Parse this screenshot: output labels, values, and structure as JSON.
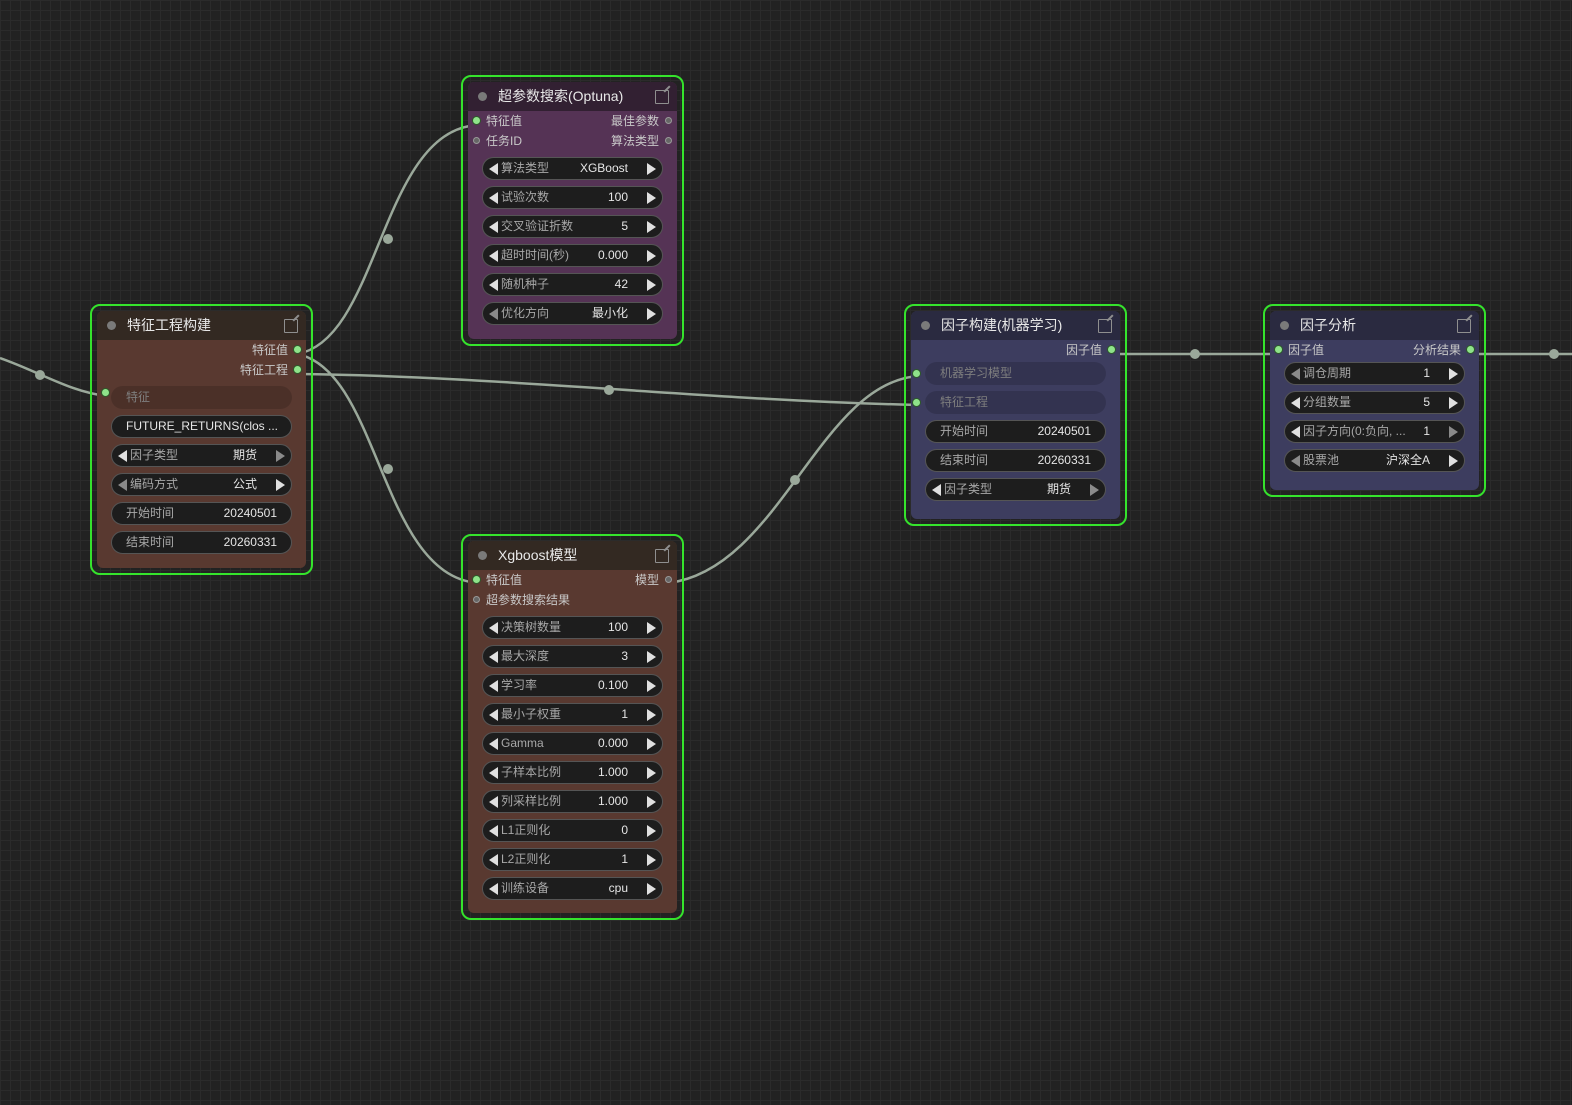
{
  "nodes": {
    "feature": {
      "title": "特征工程构建",
      "outputs": [
        "特征值",
        "特征工程"
      ],
      "input_label": "特征",
      "formula": "FUTURE_RETURNS(clos ...",
      "widgets": [
        {
          "label": "因子类型",
          "value": "期货"
        },
        {
          "label": "编码方式",
          "value": "公式"
        },
        {
          "label": "开始时间",
          "value": "20240501"
        },
        {
          "label": "结束时间",
          "value": "20260331"
        }
      ]
    },
    "optuna": {
      "title": "超参数搜索(Optuna)",
      "inputs": [
        "特征值",
        "任务ID"
      ],
      "outputs": [
        "最佳参数",
        "算法类型"
      ],
      "widgets": [
        {
          "label": "算法类型",
          "value": "XGBoost"
        },
        {
          "label": "试验次数",
          "value": "100"
        },
        {
          "label": "交叉验证折数",
          "value": "5"
        },
        {
          "label": "超时时间(秒)",
          "value": "0.000"
        },
        {
          "label": "随机种子",
          "value": "42"
        },
        {
          "label": "优化方向",
          "value": "最小化"
        }
      ]
    },
    "xgboost": {
      "title": "Xgboost模型",
      "inputs": [
        "特征值",
        "超参数搜索结果"
      ],
      "outputs": [
        "模型"
      ],
      "widgets": [
        {
          "label": "决策树数量",
          "value": "100"
        },
        {
          "label": "最大深度",
          "value": "3"
        },
        {
          "label": "学习率",
          "value": "0.100"
        },
        {
          "label": "最小子权重",
          "value": "1"
        },
        {
          "label": "Gamma",
          "value": "0.000"
        },
        {
          "label": "子样本比例",
          "value": "1.000"
        },
        {
          "label": "列采样比例",
          "value": "1.000"
        },
        {
          "label": "L1正则化",
          "value": "0"
        },
        {
          "label": "L2正则化",
          "value": "1"
        },
        {
          "label": "训练设备",
          "value": "cpu"
        }
      ]
    },
    "factor_ml": {
      "title": "因子构建(机器学习)",
      "outputs": [
        "因子值"
      ],
      "inputs": [
        "机器学习模型",
        "特征工程"
      ],
      "widgets": [
        {
          "label": "开始时间",
          "value": "20240501"
        },
        {
          "label": "结束时间",
          "value": "20260331"
        },
        {
          "label": "因子类型",
          "value": "期货"
        }
      ]
    },
    "analysis": {
      "title": "因子分析",
      "inputs": [
        "因子值"
      ],
      "outputs": [
        "分析结果"
      ],
      "widgets": [
        {
          "label": "调仓周期",
          "value": "1"
        },
        {
          "label": "分组数量",
          "value": "5"
        },
        {
          "label": "因子方向(0:负向, ...",
          "value": "1"
        },
        {
          "label": "股票池",
          "value": "沪深全A"
        }
      ]
    }
  },
  "colors": {
    "selected_border": "#35e32c",
    "link": "#9aa89a",
    "brown_body": "#593930",
    "purple_body": "#553355",
    "blue_body": "#3d3d5f"
  }
}
